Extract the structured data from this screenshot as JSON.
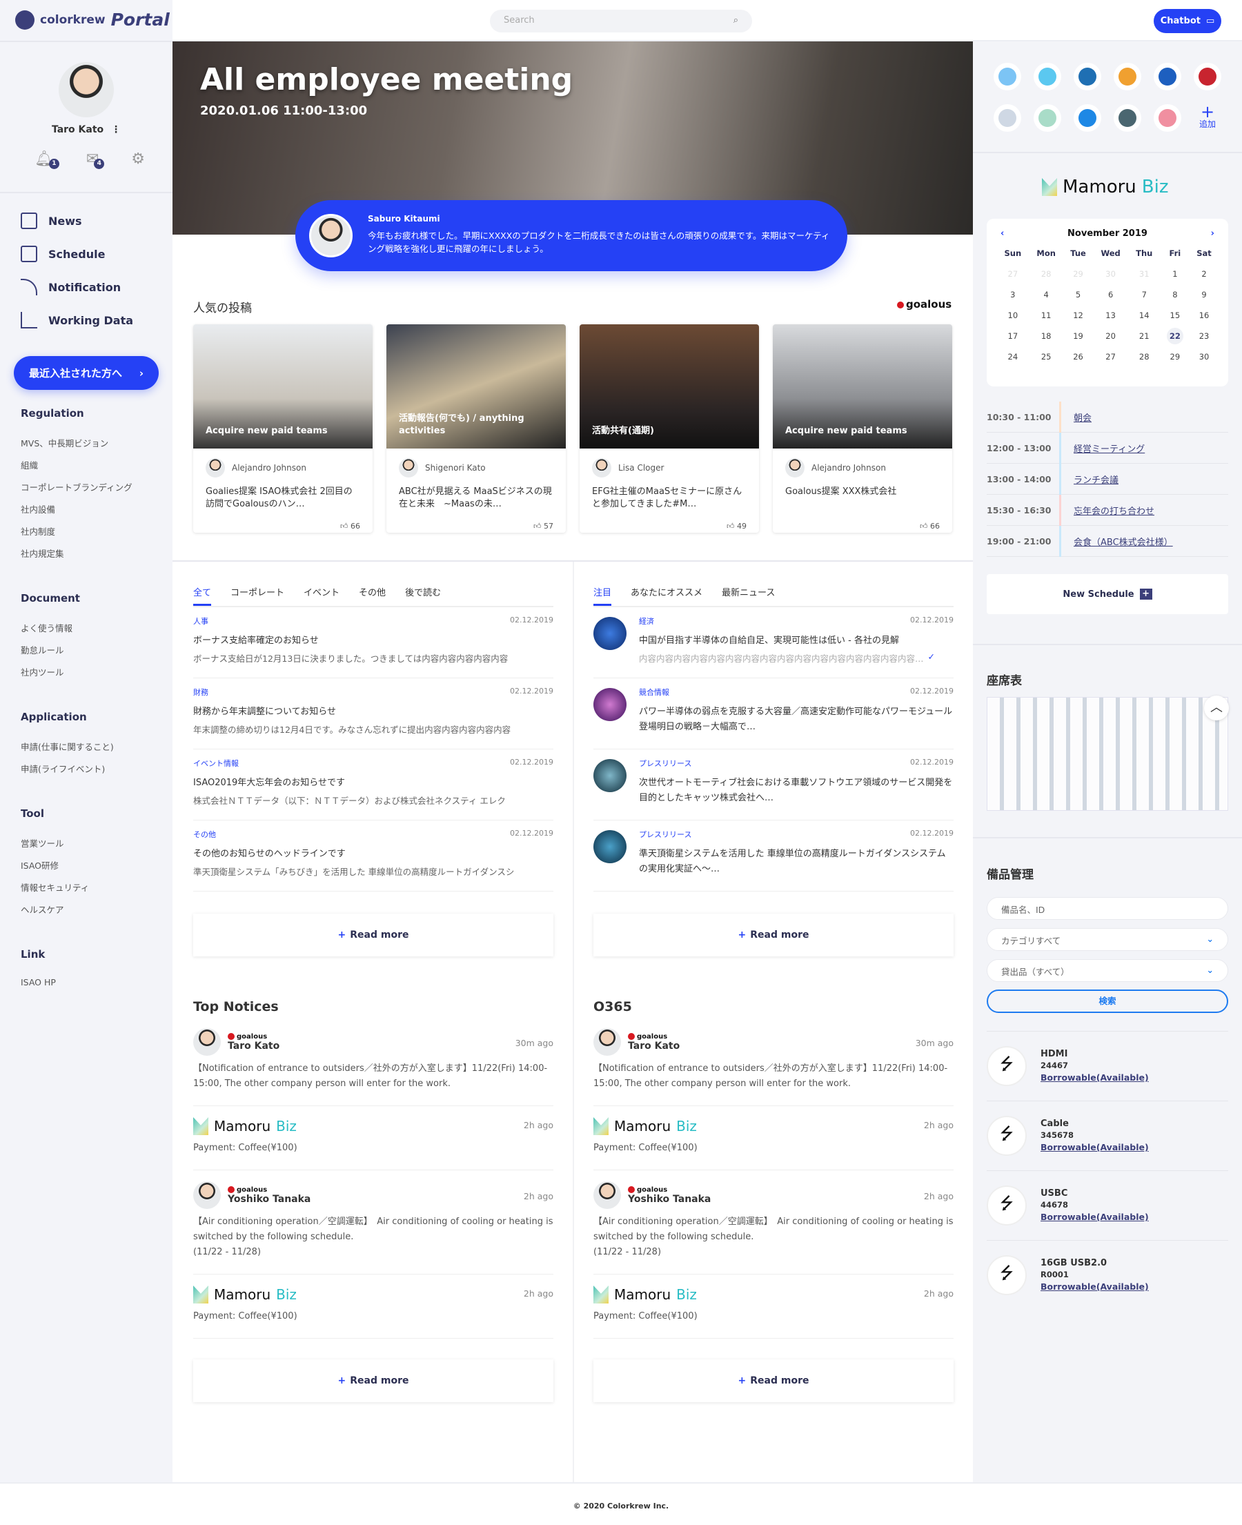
{
  "brand": {
    "company": "colorkrew",
    "product": "Portal"
  },
  "header": {
    "search_placeholder": "Search",
    "chatbot_label": "Chatbot"
  },
  "user": {
    "name": "Taro Kato",
    "notifications": "1",
    "messages": "4"
  },
  "nav": [
    {
      "label": "News",
      "icon": "newspaper-icon"
    },
    {
      "label": "Schedule",
      "icon": "calendar-icon"
    },
    {
      "label": "Notification",
      "icon": "rss-icon"
    },
    {
      "label": "Working Data",
      "icon": "chart-icon"
    }
  ],
  "new_hire_button": "最近入社された方へ",
  "link_groups": [
    {
      "title": "Regulation",
      "items": [
        "MVS、中長期ビジョン",
        "組織",
        "コーポレートブランディング",
        "社内設備",
        "社内制度",
        "社内規定集"
      ]
    },
    {
      "title": "Document",
      "items": [
        "よく使う情報",
        "勤怠ルール",
        "社内ツール"
      ]
    },
    {
      "title": "Application",
      "items": [
        "申請(仕事に関すること)",
        "申請(ライフイベント)"
      ]
    },
    {
      "title": "Tool",
      "items": [
        "営業ツール",
        "ISAO研修",
        "情報セキュリティ",
        "ヘルスケア"
      ]
    },
    {
      "title": "Link",
      "items": [
        "ISAO HP"
      ]
    }
  ],
  "hero": {
    "title": "All employee meeting",
    "datetime": "2020.01.06 11:00-13:00",
    "speaker": "Saburo Kitaumi",
    "message": "今年もお疲れ様でした。早期にXXXXのプロダクトを二桁成長できたのは皆さんの頑張りの成果です。来期はマーケティング戦略を強化し更に飛躍の年にしましょう。"
  },
  "popular": {
    "title": "人気の投稿",
    "source": "goalous",
    "cards": [
      {
        "caption": "Acquire new paid teams",
        "author": "Alejandro Johnson",
        "text": "Goalies提案 ISAO株式会社 2回目の訪問でGoalousのハン…",
        "likes": "66"
      },
      {
        "caption": "活動報告(何でも) / anything activities",
        "author": "Shigenori Kato",
        "text": "ABC社が見据える MaaSビジネスの現在と未来　~Maasの未…",
        "likes": "57"
      },
      {
        "caption": "活動共有(通期)",
        "author": "Lisa Cloger",
        "text": "EFG社主催のMaaSセミナーに原さんと参加してきました#M…",
        "likes": "49"
      },
      {
        "caption": "Acquire new paid teams",
        "author": "Alejandro Johnson",
        "text": "Goalous提案 XXX株式会社",
        "likes": "66"
      }
    ]
  },
  "news_left": {
    "tabs": [
      "全て",
      "コーポレート",
      "イベント",
      "その他",
      "後で読む"
    ],
    "items": [
      {
        "category": "人事",
        "date": "02.12.2019",
        "title": "ボーナス支給率確定のお知らせ",
        "excerpt": "ボーナス支給日が12月13日に決まりました。つきましては内容内容内容内容内容"
      },
      {
        "category": "財務",
        "date": "02.12.2019",
        "title": "財務から年末調整についてお知らせ",
        "excerpt": "年末調整の締め切りは12月4日です。みなさん忘れずに提出内容内容内容内容内容"
      },
      {
        "category": "イベント情報",
        "date": "02.12.2019",
        "title": "ISAO2019年大忘年会のお知らせです",
        "excerpt": "株式会社ＮＴＴデータ（以下：ＮＴＴデータ）および株式会社ネクスティ エレク"
      },
      {
        "category": "その他",
        "date": "02.12.2019",
        "title": "その他のお知らせのヘッドラインです",
        "excerpt": "準天頂衛星システム「みちびき」を活用した 車線単位の高精度ルートガイダンスシ"
      }
    ],
    "read_more": "Read more"
  },
  "news_right": {
    "tabs": [
      "注目",
      "あなたにオススメ",
      "最新ニュース"
    ],
    "items": [
      {
        "category": "経済",
        "date": "02.12.2019",
        "title": "中国が目指す半導体の自給自足、実現可能性は低い - 各社の見解",
        "excerpt": "内容内容内容内容内容内容内容内容内容内容内容内容内容内容内容内容…",
        "read": true
      },
      {
        "category": "競合情報",
        "date": "02.12.2019",
        "title": "パワー半導体の弱点を克服する大容量／高速安定動作可能なパワーモジュール登場明日の戦略－大幅高で…"
      },
      {
        "category": "プレスリリース",
        "date": "02.12.2019",
        "title": "次世代オートモーティブ社会における車載ソフトウエア領域のサービス開発を目的としたキャッツ株式会社へ…"
      },
      {
        "category": "プレスリリース",
        "date": "02.12.2019",
        "title": "準天頂衛星システムを活用した 車線単位の高精度ルートガイダンスシステムの実用化実証へ～…"
      }
    ],
    "read_more": "Read more"
  },
  "notices": [
    {
      "title": "Top Notices",
      "read_more": "Read more",
      "items": [
        {
          "type": "goalous",
          "source": "goalous",
          "author": "Taro Kato",
          "ago": "30m ago",
          "body": "【Notification of entrance to outsiders／社外の方が入室します】11/22(Fri) 14:00-15:00, The other company person will enter for the work."
        },
        {
          "type": "mamoru",
          "ago": "2h ago",
          "body": "Payment: Coffee(¥100)"
        },
        {
          "type": "goalous",
          "source": "goalous",
          "author": "Yoshiko Tanaka",
          "ago": "2h ago",
          "body": "【Air conditioning operation／空調運転】　Air conditioning of cooling or heating is switched by the following schedule.\n(11/22 - 11/28)"
        },
        {
          "type": "mamoru",
          "ago": "2h ago",
          "body": "Payment: Coffee(¥100)"
        }
      ]
    },
    {
      "title": "O365",
      "read_more": "Read more",
      "items": [
        {
          "type": "goalous",
          "source": "goalous",
          "author": "Taro Kato",
          "ago": "30m ago",
          "body": "【Notification of entrance to outsiders／社外の方が入室します】11/22(Fri) 14:00-15:00, The other company person will enter for the work."
        },
        {
          "type": "mamoru",
          "ago": "2h ago",
          "body": "Payment: Coffee(¥100)"
        },
        {
          "type": "goalous",
          "source": "goalous",
          "author": "Yoshiko Tanaka",
          "ago": "2h ago",
          "body": "【Air conditioning operation／空調運転】　Air conditioning of cooling or heating is switched by the following schedule.\n(11/22 - 11/28)"
        },
        {
          "type": "mamoru",
          "ago": "2h ago",
          "body": "Payment: Coffee(¥100)"
        }
      ]
    }
  ],
  "mamoru": {
    "name": "Mamoru",
    "suffix": "Biz"
  },
  "apps": {
    "colors": [
      "#7cc4f5",
      "#5bc8f0",
      "#1f6fb3",
      "#f0a030",
      "#1d5fbf",
      "#c8242f",
      "#cfd8e4",
      "#a9dcc8",
      "#1e88e5",
      "#4a6670",
      "#f08fa0"
    ],
    "add_label": "追加"
  },
  "calendar": {
    "month": "November 2019",
    "weekdays": [
      "Sun",
      "Mon",
      "Tue",
      "Wed",
      "Thu",
      "Fri",
      "Sat"
    ],
    "weeks": [
      [
        "27",
        "28",
        "29",
        "30",
        "31",
        "1",
        "2"
      ],
      [
        "3",
        "4",
        "5",
        "6",
        "7",
        "8",
        "9"
      ],
      [
        "10",
        "11",
        "12",
        "13",
        "14",
        "15",
        "16"
      ],
      [
        "17",
        "18",
        "19",
        "20",
        "21",
        "22",
        "23"
      ],
      [
        "24",
        "25",
        "26",
        "27",
        "28",
        "29",
        "30"
      ]
    ],
    "selected": "22"
  },
  "schedule": [
    {
      "time": "10:30 - 11:00",
      "title": "朝会",
      "color": "#fde0c8"
    },
    {
      "time": "12:00 - 13:00",
      "title": "経営ミーティング",
      "color": "#c9e8fb"
    },
    {
      "time": "13:00 - 14:00",
      "title": "ランチ会議",
      "color": "#c9e8fb"
    },
    {
      "time": "15:30 - 16:30",
      "title": "忘年会の打ち合わせ",
      "color": "#fbd3d3"
    },
    {
      "time": "19:00 - 21:00",
      "title": "会食（ABC株式会社様）",
      "color": "#c9e8fb"
    }
  ],
  "new_schedule": "New Schedule",
  "seat_map": {
    "title": "座席表"
  },
  "equipment": {
    "title": "備品管理",
    "search_placeholder": "備品名、ID",
    "category": "カテゴリすべて",
    "loan": "貸出品（すべて）",
    "search_button": "検索",
    "items": [
      {
        "name": "HDMI",
        "id": "24467",
        "status": "Borrowable(Available)"
      },
      {
        "name": "Cable",
        "id": "345678",
        "status": "Borrowable(Available)"
      },
      {
        "name": "USBC",
        "id": "44678",
        "status": "Borrowable(Available)"
      },
      {
        "name": "16GB USB2.0",
        "id": "R0001",
        "status": "Borrowable(Available)"
      }
    ]
  },
  "footer": "© 2020 Colorkrew Inc.",
  "colors": {
    "accent": "#2541f5",
    "navy": "#2c2f52",
    "sidebar_bg": "#f3f4f9"
  }
}
